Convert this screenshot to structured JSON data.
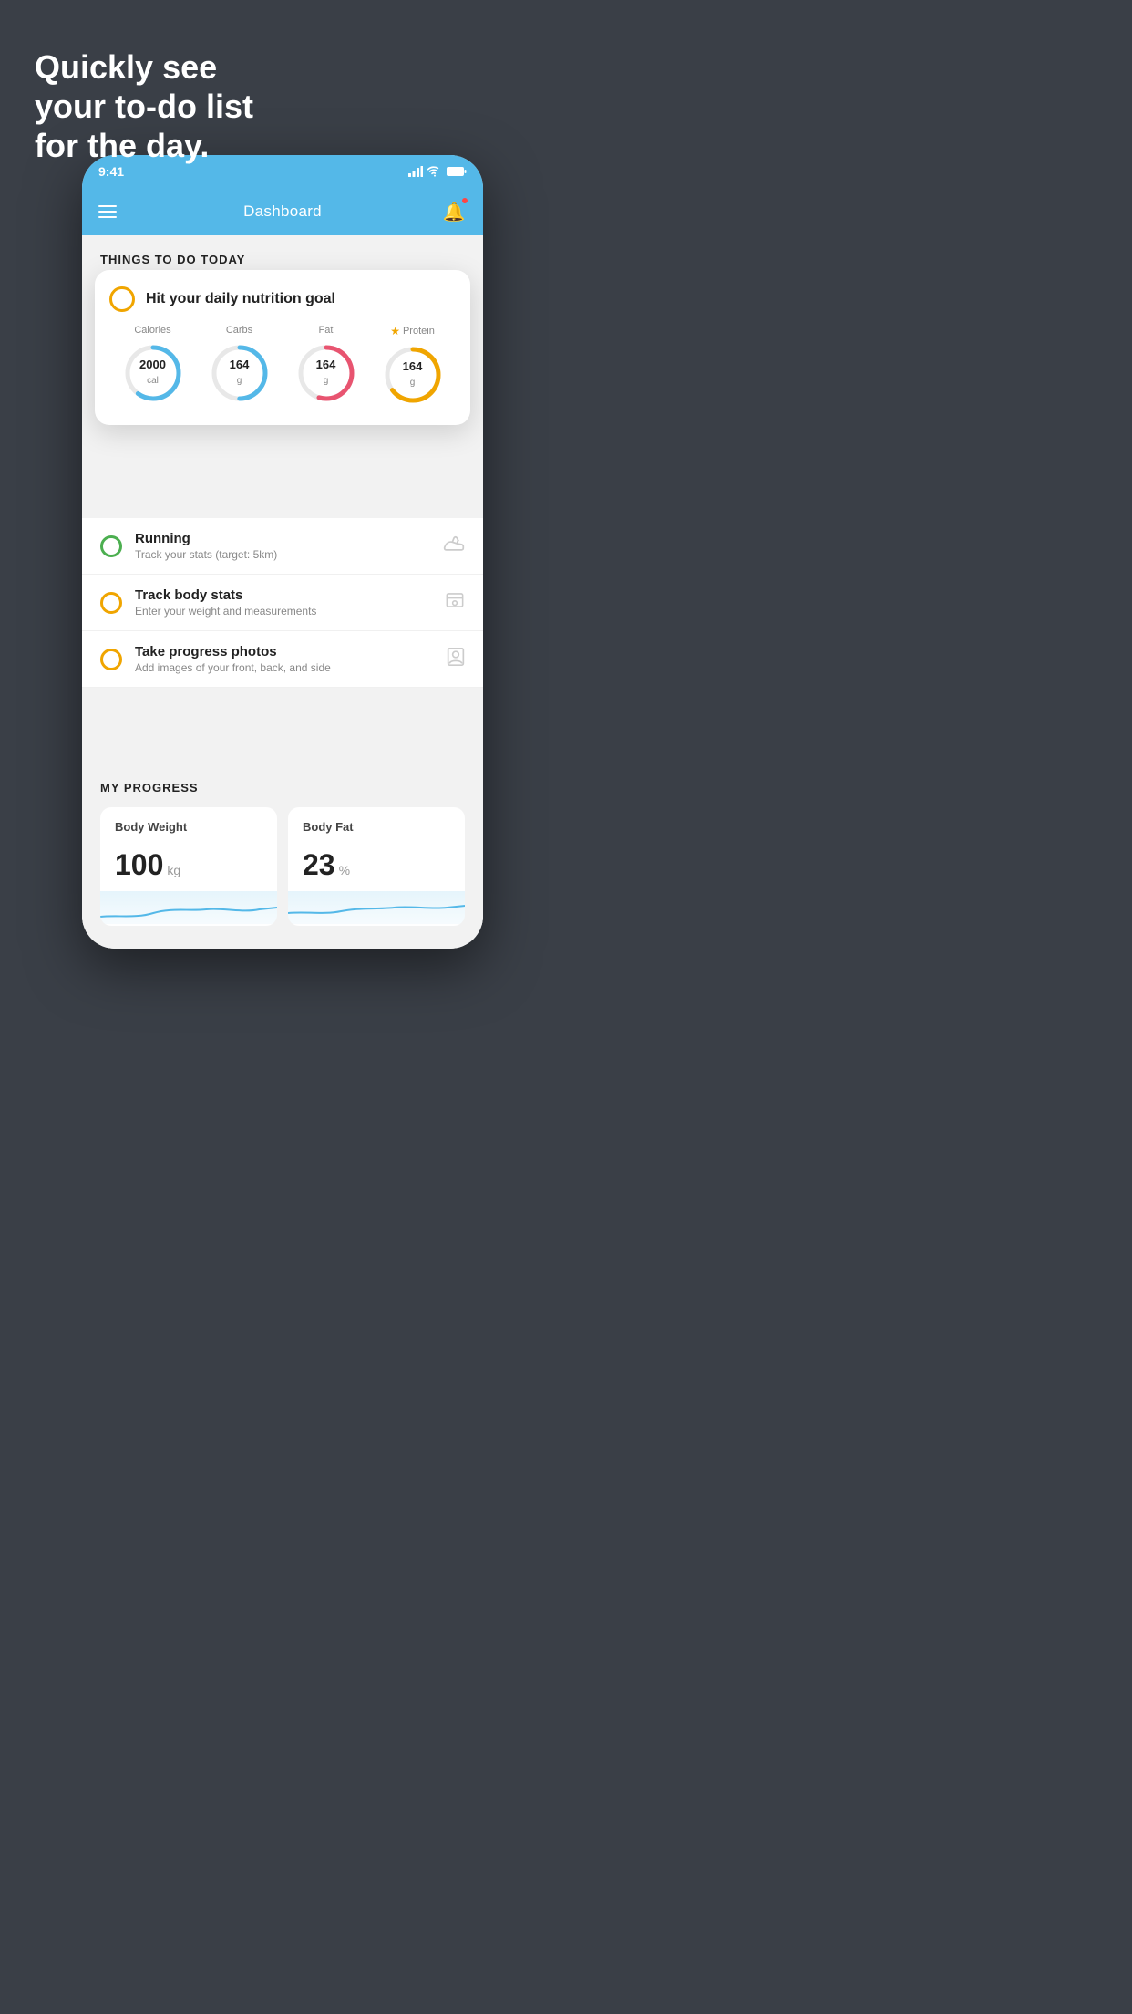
{
  "hero": {
    "line1": "Quickly see",
    "line2": "your to-do list",
    "line3": "for the day."
  },
  "status_bar": {
    "time": "9:41",
    "signal": "▋▋▋▋",
    "wifi": "wifi",
    "battery": "battery"
  },
  "nav": {
    "title": "Dashboard"
  },
  "things_section": {
    "header": "Things To Do Today"
  },
  "nutrition_card": {
    "title": "Hit your daily nutrition goal",
    "stats": [
      {
        "label": "Calories",
        "value": "2000",
        "unit": "cal",
        "color": "#54b8e8",
        "percent": 60,
        "star": false
      },
      {
        "label": "Carbs",
        "value": "164",
        "unit": "g",
        "color": "#54b8e8",
        "percent": 50,
        "star": false
      },
      {
        "label": "Fat",
        "value": "164",
        "unit": "g",
        "color": "#e85470",
        "percent": 55,
        "star": false
      },
      {
        "label": "Protein",
        "value": "164",
        "unit": "g",
        "color": "#f0a500",
        "percent": 65,
        "star": true
      }
    ]
  },
  "todo_items": [
    {
      "id": "running",
      "title": "Running",
      "subtitle": "Track your stats (target: 5km)",
      "circle_color": "green",
      "icon": "shoe"
    },
    {
      "id": "body-stats",
      "title": "Track body stats",
      "subtitle": "Enter your weight and measurements",
      "circle_color": "yellow",
      "icon": "scale"
    },
    {
      "id": "photos",
      "title": "Take progress photos",
      "subtitle": "Add images of your front, back, and side",
      "circle_color": "yellow",
      "icon": "portrait"
    }
  ],
  "progress_section": {
    "header": "My Progress",
    "cards": [
      {
        "id": "body-weight",
        "title": "Body Weight",
        "value": "100",
        "unit": "kg"
      },
      {
        "id": "body-fat",
        "title": "Body Fat",
        "value": "23",
        "unit": "%"
      }
    ]
  }
}
